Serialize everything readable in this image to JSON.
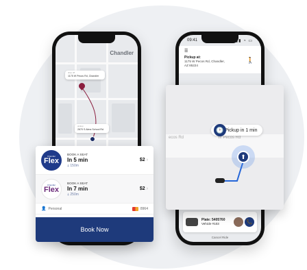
{
  "left_phone": {
    "map": {
      "city": "Chandler",
      "dropoff_card": {
        "small": "drop off",
        "address": "1175 W Pecos Rd, Chandler"
      },
      "pickup_card": {
        "small": "pickup",
        "address": "2670 S Alma School Rd"
      }
    }
  },
  "booking": {
    "options": [
      {
        "logo_small": "Chandler",
        "logo_big": "Flex",
        "kicker": "BOOK A SEAT",
        "time": "In 5 min",
        "distance": "150m",
        "price": "$2"
      },
      {
        "logo_small": "Chandler",
        "logo_big": "Flex",
        "kicker": "BOOK A SEAT",
        "time": "In 7 min",
        "distance": "250m",
        "price": "$2"
      }
    ],
    "payment": {
      "label": "Personal",
      "card_last4": "8964"
    },
    "book_button": "Book Now"
  },
  "right_phone": {
    "status_time": "09:41",
    "pickup": {
      "label": "Pickup at:",
      "address_line1": "1175 W Pecos Rd, Chandler,",
      "address_line2": "AZ 85224"
    },
    "driver": {
      "plate_label": "Plate: 5405760",
      "vehicle": "Vehicle #103",
      "driver_name": "Jason E"
    },
    "cancel_label": "Cancel Ride"
  },
  "zoom": {
    "pickup_text": "Pickup in 1 min",
    "road_label_left": "ecos Rd",
    "road_label_right": "W Pecos Rd"
  },
  "icons": {
    "person": "👤",
    "walk": "🚶",
    "clock": "🕑",
    "phone": "📞",
    "arrow_up": "⬆",
    "chevron": "›",
    "pin_distance": "⍋"
  },
  "colors": {
    "brand": "#1e3a7b",
    "dropoff_pin": "#8b1e3f",
    "flex_purple": "#6b2a7a"
  }
}
